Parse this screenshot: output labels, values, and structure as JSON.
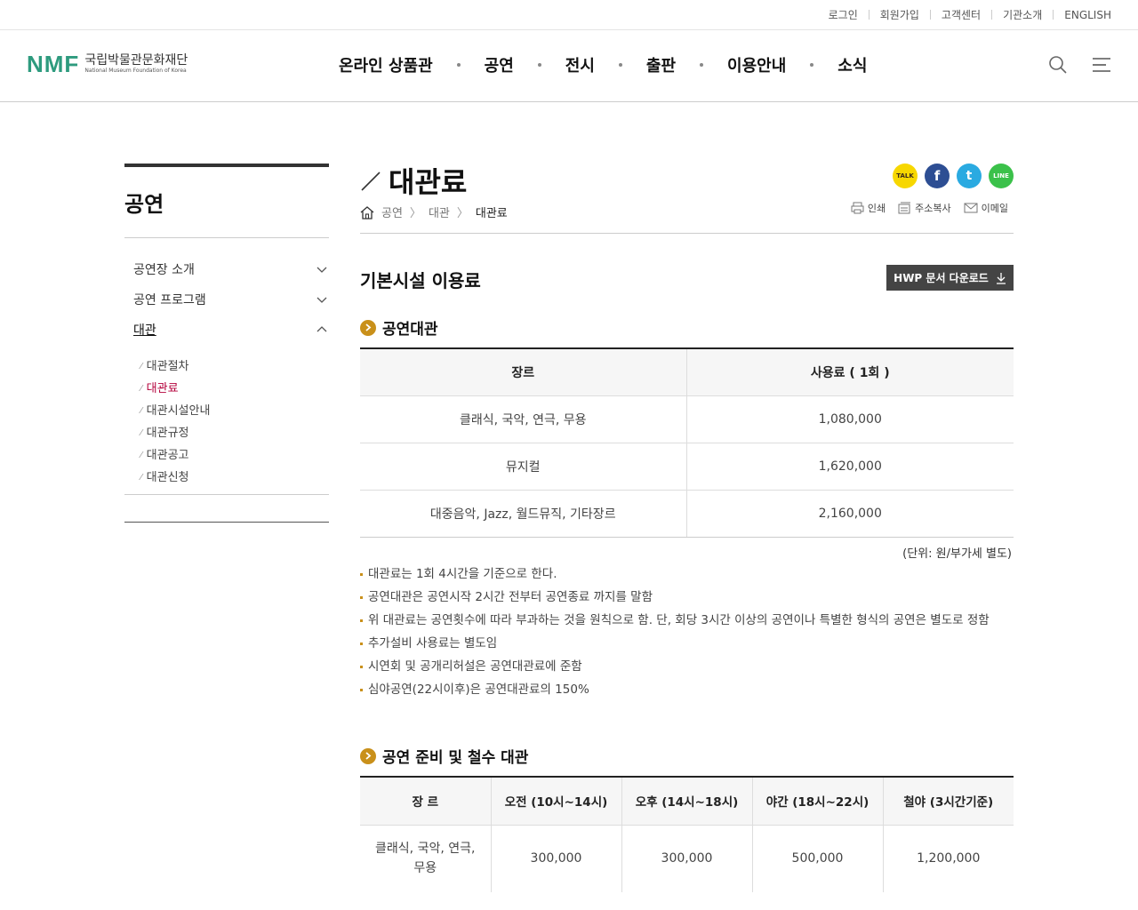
{
  "util": {
    "links": [
      "로그인",
      "회원가입",
      "고객센터",
      "기관소개",
      "ENGLISH"
    ]
  },
  "header": {
    "logo_mark": "NMF",
    "logo_ko": "국립박물관문화재단",
    "logo_en": "National Museum Foundation of Korea",
    "nav": [
      "온라인 상품관",
      "공연",
      "전시",
      "출판",
      "이용안내",
      "소식"
    ]
  },
  "lnb": {
    "title": "공연",
    "items": [
      {
        "label": "공연장 소개"
      },
      {
        "label": "공연 프로그램"
      },
      {
        "label": "대관"
      }
    ],
    "sub_items": [
      {
        "label": "대관절차"
      },
      {
        "label": "대관료"
      },
      {
        "label": "대관시설안내"
      },
      {
        "label": "대관규정"
      },
      {
        "label": "대관공고"
      },
      {
        "label": "대관신청"
      }
    ]
  },
  "page": {
    "title": "대관료",
    "breadcrumb": [
      "공연",
      "대관",
      "대관료"
    ],
    "sns": [
      "TALK",
      "f",
      "t",
      "LINE"
    ],
    "tools": [
      "인쇄",
      "주소복사",
      "이메일"
    ],
    "section_title": "기본시설 이용료",
    "download_label": "HWP 문서 다운로드"
  },
  "rental": {
    "heading": "공연대관",
    "headers": [
      "장르",
      "사용료 ( 1회 )"
    ],
    "rows": [
      [
        "클래식, 국악, 연극, 무용",
        "1,080,000"
      ],
      [
        "뮤지컬",
        "1,620,000"
      ],
      [
        "대중음악, Jazz, 월드뮤직, 기타장르",
        "2,160,000"
      ]
    ],
    "unit": "(단위: 원/부가세 별도)",
    "notes": [
      "대관료는 1회 4시간을 기준으로 한다.",
      "공연대관은 공연시작 2시간 전부터 공연종료 까지를 말함",
      "위 대관료는 공연횟수에 따라 부과하는 것을 원칙으로 함. 단, 회당 3시간 이상의 공연이나 특별한 형식의 공연은 별도로 정함",
      "추가설비 사용료는 별도임",
      "시연회 및 공개리허설은 공연대관료에 준함",
      "심야공연(22시이후)은 공연대관료의 150%"
    ]
  },
  "prep": {
    "heading": "공연 준비 및 철수 대관",
    "headers": [
      "장 르",
      "오전 (10시~14시)",
      "오후 (14시~18시)",
      "야간 (18시~22시)",
      "철야 (3시간기준)"
    ],
    "rows": [
      [
        "클래식, 국악, 연극, 무용",
        "300,000",
        "300,000",
        "500,000",
        "1,200,000"
      ]
    ]
  },
  "colors": {
    "accent": "#b4003b",
    "bullet": "#c9901a",
    "logo": "#2e9b7e",
    "kakao": "#f7d700",
    "facebook": "#2d4e93",
    "twitter": "#2aaae1",
    "line": "#3bc14a"
  }
}
